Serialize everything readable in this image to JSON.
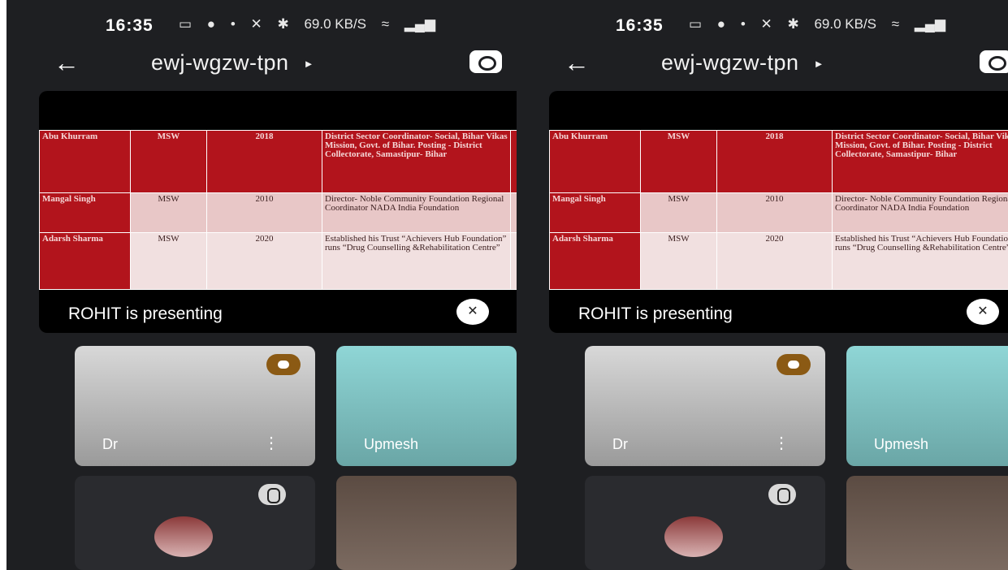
{
  "status": {
    "time": "16:35",
    "icons": [
      "camera-icon",
      "bell-icon",
      "dot",
      "mute-icon",
      "bluetooth-icon",
      "speed-icon",
      "wifi-icon",
      "call-icon",
      "volte-icon",
      "signal-icon"
    ],
    "speed": "69.0 KB/S"
  },
  "meeting": {
    "code": "ewj-wgzw-tpn"
  },
  "slide": {
    "rows": [
      {
        "name": "Abu Khurram",
        "degree": "MSW",
        "year": "2018",
        "role": "District Sector Coordinator- Social, Bihar Vikas Mission, Govt. of Bihar. Posting - District Collectorate, Samastipur- Bihar"
      },
      {
        "name": "Mangal Singh",
        "degree": "MSW",
        "year": "2010",
        "role": "Director- Noble Community Foundation Regional Coordinator NADA India Foundation"
      },
      {
        "name": "Adarsh Sharma",
        "degree": "MSW",
        "year": "2020",
        "role": "Established his Trust “Achievers Hub Foundation” runs “Drug Counselling &Rehabilitation Centre”"
      }
    ]
  },
  "presenting_label": "ROHIT is presenting",
  "tiles": {
    "dr_name": "Dr",
    "upmesh_name": "Upmesh"
  }
}
